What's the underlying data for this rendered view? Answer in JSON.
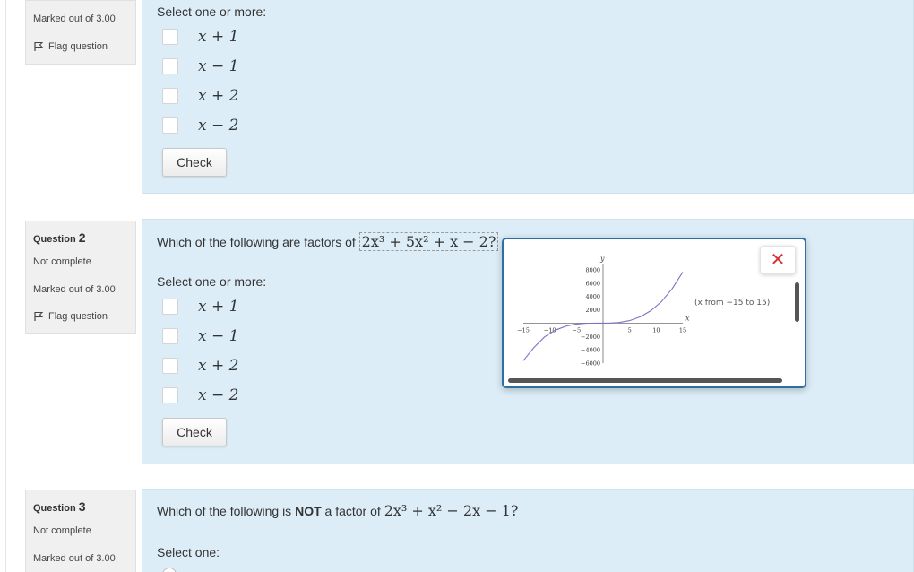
{
  "q1": {
    "marked": "Marked out of 3.00",
    "flag": "Flag question",
    "prompt": "Select one or more:",
    "options": [
      "x + 1",
      "x − 1",
      "x + 2",
      "x − 2"
    ],
    "check": "Check"
  },
  "q2": {
    "label": "Question",
    "number": "2",
    "status": "Not complete",
    "marked": "Marked out of 3.00",
    "flag": "Flag question",
    "question_text": "Which of the following are factors of",
    "question_math": "2x³ + 5x² + x − 2?",
    "prompt": "Select one or more:",
    "options": [
      "x + 1",
      "x − 1",
      "x + 2",
      "x − 2"
    ],
    "check": "Check"
  },
  "q3": {
    "label": "Question",
    "number": "3",
    "status": "Not complete",
    "marked": "Marked out of 3.00",
    "question_text_pre": "Which of the following is",
    "question_text_bold": "NOT",
    "question_text_post": "a factor of",
    "question_math": "2x³ + x² − 2x − 1?",
    "prompt": "Select one:"
  },
  "popup": {
    "close_symbol": "✕",
    "range_note": "(x from −15 to 15)"
  },
  "chart_data": {
    "type": "line",
    "function": "2x^3 + 5x^2 + x - 2",
    "xlabel": "x",
    "ylabel": "y",
    "xlim": [
      -15,
      15
    ],
    "ylim": [
      -6000,
      8000
    ],
    "x_ticks": [
      "-15",
      "-10",
      "-5",
      "5",
      "10",
      "15"
    ],
    "y_ticks": [
      "8000",
      "6000",
      "4000",
      "2000",
      "-2000",
      "-4000",
      "-6000"
    ],
    "series": [
      {
        "x": [
          -15,
          -13,
          -11,
          -9,
          -7,
          -5,
          -3,
          -1,
          0,
          1,
          3,
          5,
          7,
          9,
          11,
          13,
          15
        ],
        "y": [
          -5642,
          -3654,
          -2068,
          -1064,
          -448,
          -132,
          -12,
          0,
          -2,
          6,
          94,
          378,
          942,
          1870,
          3246,
          5154,
          7678
        ]
      }
    ],
    "color": "#7b74c4"
  }
}
